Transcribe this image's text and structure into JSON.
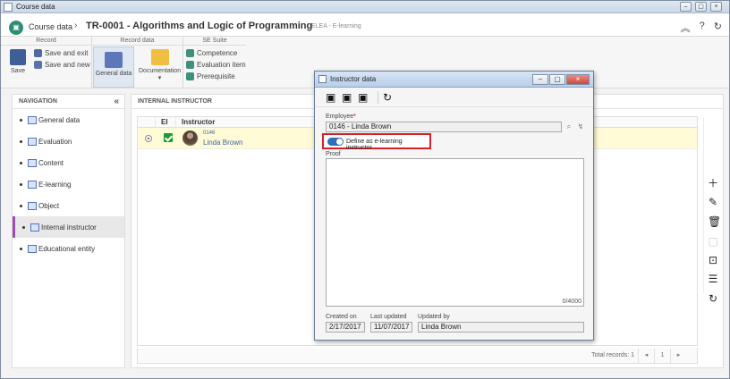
{
  "window": {
    "title": "Course data"
  },
  "header": {
    "crumb": "Course data",
    "separator": "›",
    "title": "TR-0001 - Algorithms and Logic of Programming",
    "tag": "ELEA - E-learning"
  },
  "toolbar": {
    "groups": {
      "record": "Record",
      "record_data": "Record data",
      "se_suite": "SE Suite"
    },
    "save": "Save",
    "save_exit": "Save and exit",
    "save_new": "Save and new",
    "general_data": "General data",
    "documentation": "Documentation",
    "competence": "Competence",
    "evaluation_item": "Evaluation item",
    "prerequisite": "Prerequisite"
  },
  "nav": {
    "title": "NAVIGATION",
    "items": [
      {
        "label": "General data"
      },
      {
        "label": "Evaluation"
      },
      {
        "label": "Content"
      },
      {
        "label": "E-learning"
      },
      {
        "label": "Object"
      },
      {
        "label": "Internal instructor"
      },
      {
        "label": "Educational entity"
      }
    ]
  },
  "content": {
    "title": "INTERNAL INSTRUCTOR",
    "columns": {
      "el": "El",
      "instructor": "Instructor"
    },
    "row": {
      "code": "0146",
      "name": "Linda Brown"
    },
    "pager": {
      "text": "Total records: 1",
      "page": "1"
    }
  },
  "dialog": {
    "title": "Instructor data",
    "employee_label": "Employee",
    "employee_value": "0146 - Linda Brown",
    "toggle_label": "Define as e-learning instructor",
    "proof_label": "Proof",
    "counter": "0/4000",
    "created_on_label": "Created on",
    "created_on": "2/17/2017",
    "last_updated_label": "Last updated",
    "last_updated": "11/07/2017",
    "updated_by_label": "Updated by",
    "updated_by": "Linda Brown"
  }
}
